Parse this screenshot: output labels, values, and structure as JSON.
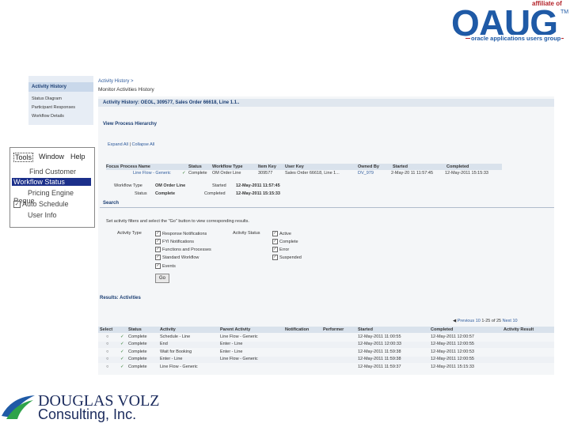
{
  "logos": {
    "oaug_affiliate": "affiliate of",
    "oaug_name": "OAUG",
    "oaug_tm": "TM",
    "oaug_tagline": "oracle applications users group",
    "dv_line1": "DOUGLAS VOLZ",
    "dv_line2": "Consulting, Inc."
  },
  "left_nav": {
    "header": "Activity History",
    "items": [
      "Status Diagram",
      "Participant Responses",
      "Workflow Details"
    ]
  },
  "breadcrumb": "Activity History >",
  "page_title": "Monitor Activities History",
  "history_bar": "Activity History: OEOL, 309577, Sales Order 66618, Line 1.1..",
  "hierarchy": {
    "title": "View Process Hierarchy",
    "expand_all": "Expand All",
    "separator": "|",
    "collapse_all": "Collapse All",
    "columns": [
      "Focus",
      "Process Name",
      "Status",
      "Workflow Type",
      "Item Key",
      "User Key",
      "Owned By",
      "Started",
      "Completed"
    ],
    "row": {
      "process": "Line Flow - Generic",
      "status": "Complete",
      "type": "OM Order Line",
      "item_key": "309577",
      "user_key": "Sales Order 66618, Line 1...",
      "owned": "DV_979",
      "started": "2-May-20 11 11:57:45",
      "completed": "12-May-2011 15:15:33"
    },
    "wf_type_label": "Workflow Type",
    "wf_type_value": "OM Order Line",
    "started_label": "Started",
    "started_value": "12-May-2011 11:57:45",
    "status_label": "Status",
    "status_value": "Complete",
    "completed_label": "Completed",
    "completed_value": "12-May-2011 15:15:33"
  },
  "search": {
    "title": "Search",
    "instructions": "Set activity filters and select the \"Go\" button to view corresponding results.",
    "type_label": "Activity Type",
    "types": [
      "Response Notifications",
      "FYI Notifications",
      "Functions and Processes",
      "Standard Workflow",
      "Events"
    ],
    "status_label": "Activity Status",
    "statuses": [
      "Active",
      "Complete",
      "Error",
      "Suspended"
    ],
    "go_label": "Go"
  },
  "results": {
    "title": "Results: Activities",
    "previous": "Previous 10",
    "range": "1-25 of 25",
    "next": "Next 10",
    "columns": [
      "Select",
      "Status",
      "Activity",
      "Parent Activity",
      "Notification",
      "Performer",
      "Started",
      "Completed",
      "Activity Result"
    ],
    "rows": [
      {
        "status": "Complete",
        "activity": "Schedule - Line",
        "parent": "Line Flow - Generic",
        "started": "12-May-2011 11:00:55",
        "completed": "12-May-2011 12:00:57"
      },
      {
        "status": "Complete",
        "activity": "End",
        "parent": "Enter - Line",
        "started": "12-May-2011 12:00:33",
        "completed": "12-May-2011 12:00:55"
      },
      {
        "status": "Complete",
        "activity": "Wait for Booking",
        "parent": "Enter - Line",
        "started": "12-May-2011 11:59:38",
        "completed": "12-May-2011 12:00:53"
      },
      {
        "status": "Complete",
        "activity": "Enter - Line",
        "parent": "Line Flow - Generic",
        "started": "12-May-2011 11:59:38",
        "completed": "12-May-2011 12:00:55"
      },
      {
        "status": "Complete",
        "activity": "Line Flow - Generic",
        "parent": "",
        "started": "12-May-2011 11:59:37",
        "completed": "12-May-2011 15:15:33"
      }
    ]
  },
  "tools_menu": {
    "bar": [
      "Tools",
      "Window",
      "Help"
    ],
    "items": [
      "Find Customer",
      "Workflow Status",
      "Pricing Engine Reque",
      "Auto Schedule",
      "User Info"
    ],
    "selected_index": 1
  }
}
